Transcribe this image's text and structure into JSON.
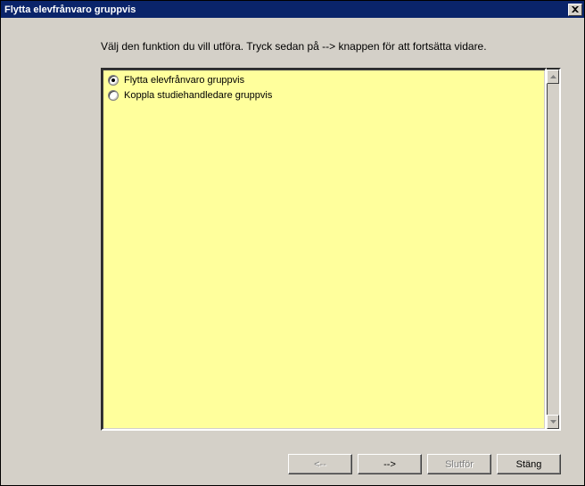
{
  "window": {
    "title": "Flytta elevfrånvaro gruppvis"
  },
  "instruction": "Välj den funktion du vill utföra. Tryck sedan på --> knappen för att fortsätta vidare.",
  "options": [
    {
      "label": "Flytta elevfrånvaro gruppvis",
      "checked": true
    },
    {
      "label": "Koppla studiehandledare gruppvis",
      "checked": false
    }
  ],
  "buttons": {
    "back": "<--",
    "next": "-->",
    "finish": "Slutför",
    "close": "Stäng"
  }
}
